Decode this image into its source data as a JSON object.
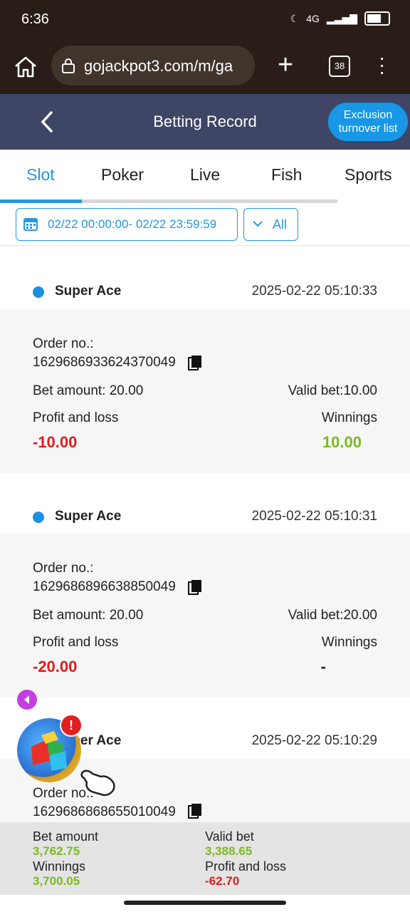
{
  "status_bar": {
    "time": "6:36",
    "network": "4G"
  },
  "browser": {
    "url": "gojackpot3.com/m/ga",
    "tab_count": "38"
  },
  "header": {
    "title": "Betting Record",
    "exclusion_label": "Exclusion turnover list"
  },
  "tabs": [
    {
      "label": "Slot",
      "active": true
    },
    {
      "label": "Poker"
    },
    {
      "label": "Live"
    },
    {
      "label": "Fish"
    },
    {
      "label": "Sports"
    }
  ],
  "filters": {
    "date_range": "02/22 00:00:00- 02/22 23:59:59",
    "type": "All"
  },
  "records": [
    {
      "game": "Super Ace",
      "time": "2025-02-22 05:10:33",
      "order_label": "Order no.:",
      "order_no": "1629686933624370049",
      "bet_amount": "Bet amount: 20.00",
      "valid_bet": "Valid bet:10.00",
      "profit_label": "Profit and loss",
      "profit": "-10.00",
      "winnings_label": "Winnings",
      "winnings": "10.00"
    },
    {
      "game": "Super Ace",
      "time": "2025-02-22 05:10:31",
      "order_label": "Order no.:",
      "order_no": "1629686896638850049",
      "bet_amount": "Bet amount: 20.00",
      "valid_bet": "Valid bet:20.00",
      "profit_label": "Profit and loss",
      "profit": "-20.00",
      "winnings_label": "Winnings",
      "winnings": "-"
    },
    {
      "game": "Super Ace",
      "time": "2025-02-22 05:10:29",
      "order_label": "Order no.:",
      "order_no": "1629686868655010049"
    }
  ],
  "summary": {
    "bet_label": "Bet amount",
    "bet_value": "3,762.75",
    "valid_label": "Valid bet",
    "valid_value": "3,388.65",
    "winnings_label": "Winnings",
    "winnings_value": "3,700.05",
    "profit_label": "Profit and loss",
    "profit_value": "-62.70"
  },
  "floating": {
    "alert": "!"
  },
  "colors": {
    "accent": "#2896e0",
    "header_bg": "#3e4565",
    "loss": "#e31b1b",
    "gain": "#7cba1f"
  }
}
